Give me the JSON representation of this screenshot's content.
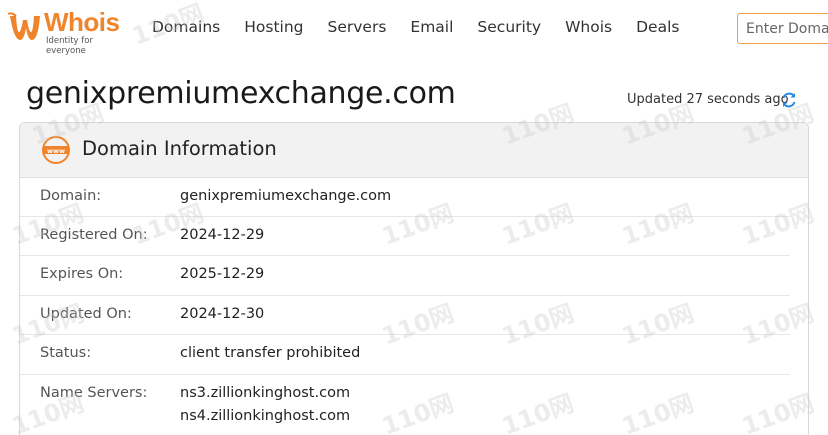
{
  "header": {
    "logo": {
      "word": "Whois",
      "tagline": "Identity for everyone"
    },
    "nav": [
      "Domains",
      "Hosting",
      "Servers",
      "Email",
      "Security",
      "Whois",
      "Deals"
    ],
    "search_placeholder": "Enter Domain"
  },
  "page": {
    "title": "genixpremiumexchange.com",
    "updated": "Updated 27 seconds ago"
  },
  "card": {
    "title": "Domain Information",
    "rows": [
      {
        "label": "Domain:",
        "value": "genixpremiumexchange.com"
      },
      {
        "label": "Registered On:",
        "value": "2024-12-29"
      },
      {
        "label": "Expires On:",
        "value": "2025-12-29"
      },
      {
        "label": "Updated On:",
        "value": "2024-12-30"
      },
      {
        "label": "Status:",
        "value": "client transfer prohibited"
      },
      {
        "label": "Name Servers:",
        "value": "ns3.zillionkinghost.com",
        "value2": "ns4.zillionkinghost.com"
      }
    ]
  },
  "colors": {
    "brand": "#f0842a",
    "refresh": "#2a8ae0"
  },
  "watermark": "110网"
}
